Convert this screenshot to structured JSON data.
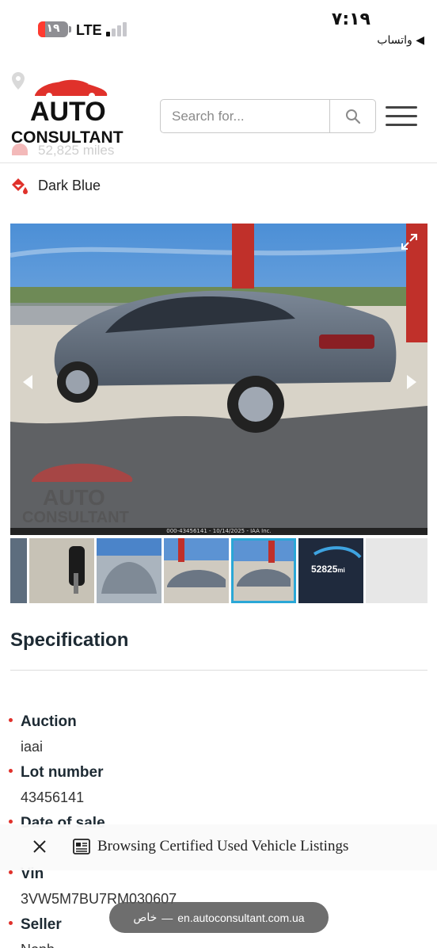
{
  "status_bar": {
    "battery_level": "١٩",
    "network": "LTE",
    "time": "٧:١٩",
    "back_app": "◀ واتساب"
  },
  "header_ghost": {
    "location": "E...",
    "miles": "52,825 miles"
  },
  "logo": {
    "word1": "AUTO",
    "word2": "CONSULTANT"
  },
  "search": {
    "placeholder": "Search for..."
  },
  "details": {
    "color_label": "Dark Blue"
  },
  "gallery": {
    "caption": "000-43456141 - 10/14/2025 - IAA Inc.",
    "watermark_word1": "AUTO",
    "watermark_word2": "CONSULTANT",
    "odometer_value": "52825",
    "odometer_unit": "mi"
  },
  "spec": {
    "title": "Specification",
    "items": [
      {
        "key": "Auction",
        "value": "iaai"
      },
      {
        "key": "Lot number",
        "value": "43456141"
      },
      {
        "key": "Date of sale",
        "value": ""
      },
      {
        "key": "Vin",
        "value": "3VW5M7BU7RM030607"
      },
      {
        "key": "Seller",
        "value": "Nonh..."
      }
    ]
  },
  "floating_bar": {
    "title": "Browsing Certified Used Vehicle Listings"
  },
  "url_pill": {
    "domain": "en.autoconsultant.com.ua",
    "mode": "خاص"
  },
  "colors": {
    "accent_red": "#e0312b",
    "thumb_active": "#2aa7d6"
  }
}
